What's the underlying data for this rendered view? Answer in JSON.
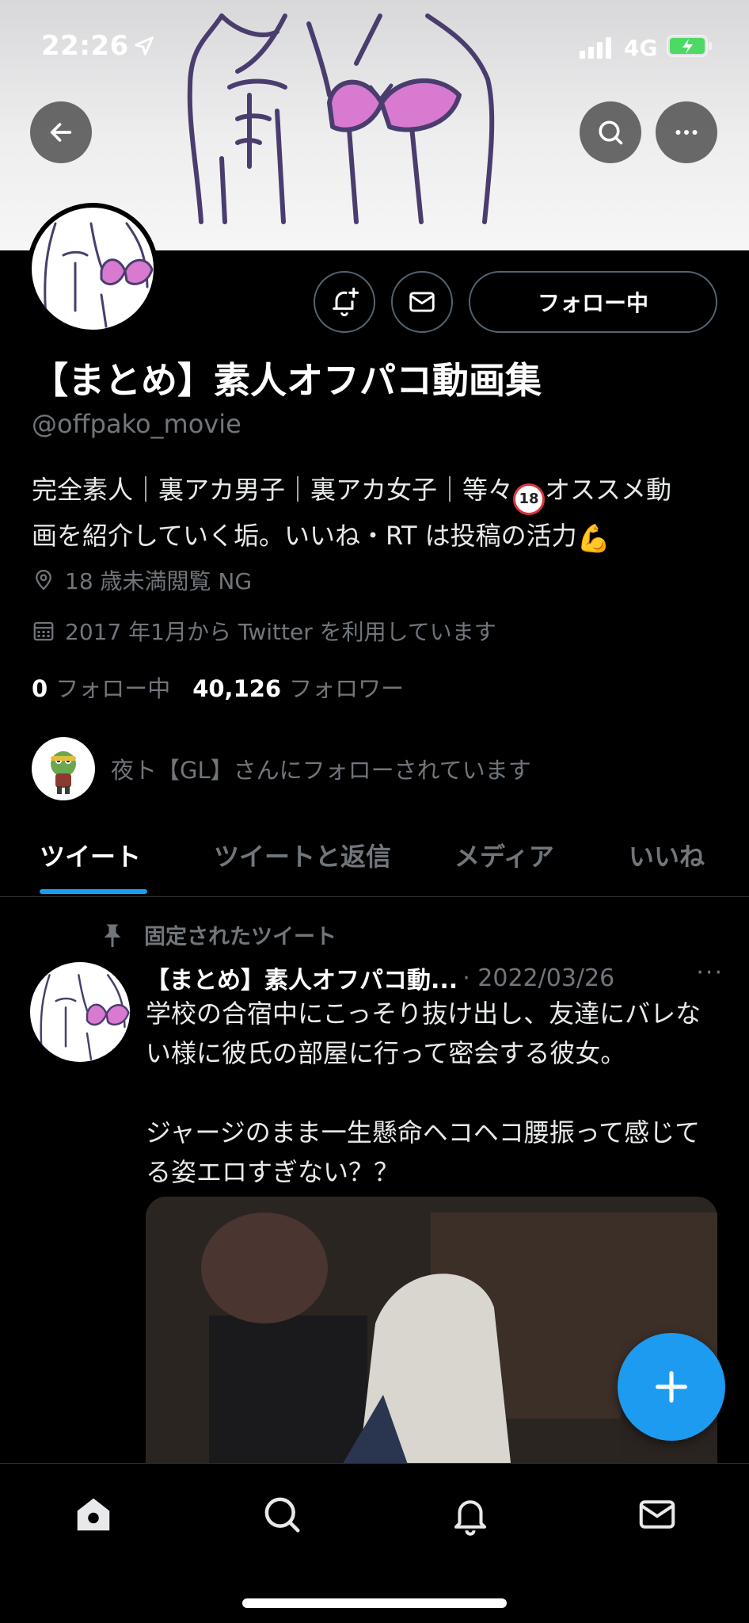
{
  "status_bar": {
    "time": "22:26",
    "network": "4G"
  },
  "profile": {
    "follow_button": "フォロー中",
    "name": "【まとめ】素人オフパコ動画集",
    "handle": "@offpako_movie",
    "bio_line1_a": "完全素人｜裏アカ男子｜裏アカ女子｜等々",
    "bio_emoji": "18",
    "bio_line1_b": "オススメ動",
    "bio_line2": "画を紹介していく垢。いいね・RT は投稿の活力",
    "location": "18 歳未満閲覧 NG",
    "joined": "2017 年1月から Twitter を利用しています",
    "following_count": "0",
    "following_label": "フォロー中",
    "followers_count": "40,126",
    "followers_label": "フォロワー",
    "followed_by": "夜ト【GL】さんにフォローされています"
  },
  "tabs": [
    {
      "label": "ツイート",
      "active": true
    },
    {
      "label": "ツイートと返信",
      "active": false
    },
    {
      "label": "メディア",
      "active": false
    },
    {
      "label": "いいね",
      "active": false
    }
  ],
  "pinned_tweet": {
    "pinned_label": "固定されたツイート",
    "author": "【まとめ】素人オフパコ動...",
    "date": "· 2022/03/26",
    "more": "···",
    "text": "学校の合宿中にこっそり抜け出し、友達にバレない様に彼氏の部屋に行って密会する彼女。\n\nジャージのまま一生懸命ヘコヘコ腰振って感じてる姿エロすぎない？？"
  },
  "colors": {
    "accent": "#1d9bf0",
    "muted": "#71767b",
    "background": "#000000",
    "bra_pink": "#d87ad0",
    "line_art": "#4a3d6e"
  },
  "icons": [
    "back-arrow-icon",
    "search-icon",
    "more-icon",
    "bell-plus-icon",
    "mail-icon",
    "location-pin-icon",
    "calendar-icon",
    "pin-icon",
    "compose-plus-icon",
    "home-icon",
    "search-nav-icon",
    "notifications-icon",
    "messages-icon"
  ]
}
